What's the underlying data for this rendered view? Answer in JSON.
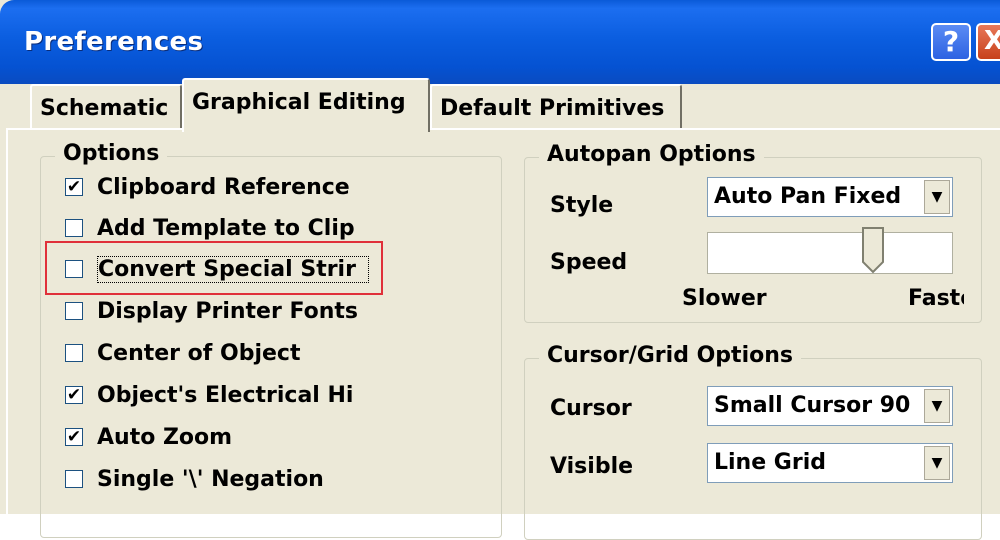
{
  "window": {
    "title": "Preferences",
    "help_glyph": "?",
    "close_glyph": "X"
  },
  "tabs": [
    {
      "label": "Schematic"
    },
    {
      "label": "Graphical Editing",
      "active": true
    },
    {
      "label": "Default Primitives"
    }
  ],
  "options": {
    "title": "Options",
    "items": [
      {
        "label": "Clipboard Reference",
        "checked": true,
        "check_glyph": "✔"
      },
      {
        "label": "Add Template to Clip",
        "checked": false,
        "check_glyph": ""
      },
      {
        "label": "Convert Special Strir",
        "checked": false,
        "check_glyph": ""
      },
      {
        "label": "Display Printer Fonts",
        "checked": false,
        "check_glyph": ""
      },
      {
        "label": "Center of Object",
        "checked": false,
        "check_glyph": ""
      },
      {
        "label": "Object's Electrical Hi",
        "checked": true,
        "check_glyph": "✔"
      },
      {
        "label": "Auto Zoom",
        "checked": true,
        "check_glyph": "✔"
      },
      {
        "label": "Single '\\' Negation",
        "checked": false,
        "check_glyph": ""
      }
    ]
  },
  "autopan": {
    "title": "Autopan Options",
    "style_label": "Style",
    "style_value": "Auto Pan Fixed",
    "speed_label": "Speed",
    "slower_label": "Slower",
    "faster_label": "Faster",
    "speed_level": 0.7
  },
  "cursor_grid": {
    "title": "Cursor/Grid Options",
    "cursor_label": "Cursor",
    "cursor_value": "Small Cursor 90",
    "visible_label": "Visible",
    "visible_value": "Line Grid"
  },
  "icons": {
    "dropdown": "▼"
  },
  "colors": {
    "title_bar": "#0a5ad8",
    "highlight_frame": "#e0303a",
    "dialog_bg": "#ece9d8"
  }
}
